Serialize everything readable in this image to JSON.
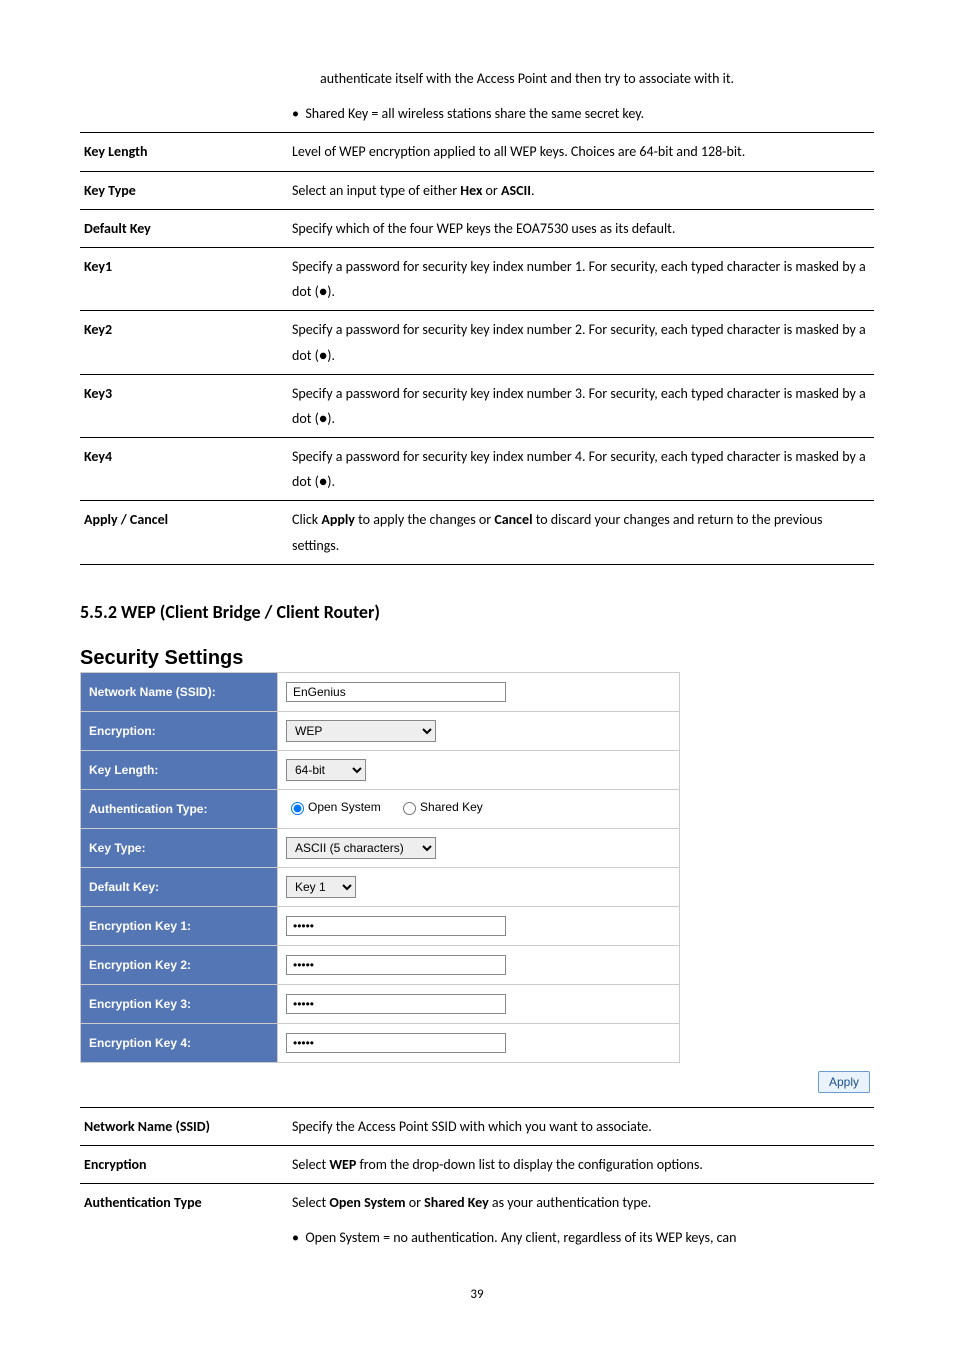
{
  "topTable": {
    "row0_col2_line1": "authenticate itself with the Access Point and then try to associate with it.",
    "row0_col2_bullet": "Shared Key = all wireless stations share the same secret key.",
    "keyLengthLabel": "Key Length",
    "keyLengthDesc": "Level of WEP encryption applied to all WEP keys. Choices are 64-bit and 128-bit.",
    "keyTypeLabel": "Key Type",
    "keyTypeDescPrefix": "Select an input type of either ",
    "keyTypeHex": "Hex",
    "keyTypeOr": " or ",
    "keyTypeAscii": "ASCII",
    "keyTypeSuffix": ".",
    "defaultKeyLabel": "Default Key",
    "defaultKeyDesc": "Specify which of the four WEP keys the EOA7530 uses as its default.",
    "key1Label": "Key1",
    "key1Desc": "Specify a password for security key index number 1. For security, each typed character is masked by a dot (●).",
    "key2Label": "Key2",
    "key2Desc": "Specify a password for security key index number 2. For security, each typed character is masked by a dot (●).",
    "key3Label": "Key3",
    "key3Desc": "Specify a password for security key index number 3. For security, each typed character is masked by a dot (●).",
    "key4Label": "Key4",
    "key4Desc": "Specify a password for security key index number 4. For security, each typed character is masked by a dot (●).",
    "applyCancelLabel": "Apply / Cancel",
    "applyCancelDescPrefix": "Click ",
    "applyWord": "Apply",
    "applyCancelDescMid": " to apply the changes or ",
    "cancelWord": "Cancel",
    "applyCancelDescSuffix": " to discard your changes and return to the previous settings."
  },
  "sectionHeading": "5.5.2 WEP (Client Bridge / Client Router)",
  "securitySettingsHeading": "Security Settings",
  "form": {
    "ssidLabel": "Network Name (SSID):",
    "ssidValue": "EnGenius",
    "encryptionLabel": "Encryption:",
    "encryptionValue": "WEP",
    "keyLengthLabel": "Key Length:",
    "keyLengthValue": "64-bit",
    "authTypeLabel": "Authentication Type:",
    "authOpen": "Open System",
    "authShared": "Shared Key",
    "keyTypeLabel": "Key Type:",
    "keyTypeValue": "ASCII (5 characters)",
    "defaultKeyLabel": "Default Key:",
    "defaultKeyValue": "Key 1",
    "encKey1Label": "Encryption Key 1:",
    "encKey2Label": "Encryption Key 2:",
    "encKey3Label": "Encryption Key 3:",
    "encKey4Label": "Encryption Key 4:",
    "maskedValue": "•••••",
    "applyButton": "Apply"
  },
  "bottomTable": {
    "ssidLabel": "Network Name (SSID)",
    "ssidDesc": "Specify the Access Point SSID with which you want to associate.",
    "encryptionLabel": "Encryption",
    "encryptionDescPrefix": "Select ",
    "encryptionWep": "WEP",
    "encryptionDescSuffix": " from the drop-down list to display the configuration options.",
    "authTypeLabel": "Authentication Type",
    "authTypeDescPrefix": "Select ",
    "authOpen": "Open System",
    "authOr": " or ",
    "authShared": "Shared Key",
    "authSuffix": " as your authentication type.",
    "authBullet": "Open System = no authentication. Any client, regardless of its WEP keys, can"
  },
  "pageNumber": "39"
}
